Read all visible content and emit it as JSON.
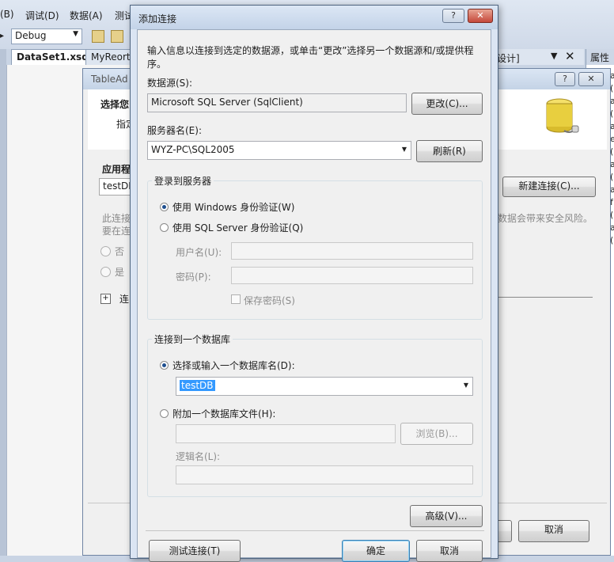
{
  "ide": {
    "menu": [
      "(B)",
      "调试(D)",
      "数据(A)",
      "测试"
    ],
    "config": "Debug",
    "tabs": [
      "DataSet1.xsd",
      "MyReort"
    ],
    "right_tab_fragment": "设计]",
    "properties_tab": "属性",
    "properties_fragments": [
      "a",
      "(",
      "a",
      "(",
      "a",
      "e",
      "(",
      "a",
      "(",
      "a",
      "f",
      "(",
      "a",
      "("
    ]
  },
  "wizard": {
    "title": "TableAd",
    "heading": "选择您",
    "subheading": "指定",
    "app_label": "应用程",
    "connection_value": "testDB",
    "new_connection_button": "新建连接(C)...",
    "note_line1": "此连接",
    "note_line2": "要在连",
    "note_right": "数据会带来安全风险。",
    "radio_no": "否",
    "radio_yes": "是",
    "expand_label": "连",
    "cancel_button": "取消"
  },
  "dialog": {
    "title": "添加连接",
    "help_button": "?",
    "close_button": "✕",
    "description": "输入信息以连接到选定的数据源，或单击“更改”选择另一个数据源和/或提供程序。",
    "datasource_label": "数据源(S):",
    "datasource_value": "Microsoft SQL Server (SqlClient)",
    "change_button": "更改(C)...",
    "server_label": "服务器名(E):",
    "server_value": "WYZ-PC\\SQL2005",
    "refresh_button": "刷新(R)",
    "login_group": "登录到服务器",
    "windows_auth": "使用 Windows 身份验证(W)",
    "sql_auth": "使用 SQL Server 身份验证(Q)",
    "username_label": "用户名(U):",
    "password_label": "密码(P):",
    "save_password": "保存密码(S)",
    "db_group": "连接到一个数据库",
    "select_db": "选择或输入一个数据库名(D):",
    "db_value": "testDB",
    "attach_db": "附加一个数据库文件(H):",
    "browse_button": "浏览(B)...",
    "logical_name_label": "逻辑名(L):",
    "advanced_button": "高级(V)...",
    "test_button": "测试连接(T)",
    "ok_button": "确定",
    "cancel_button": "取消"
  }
}
